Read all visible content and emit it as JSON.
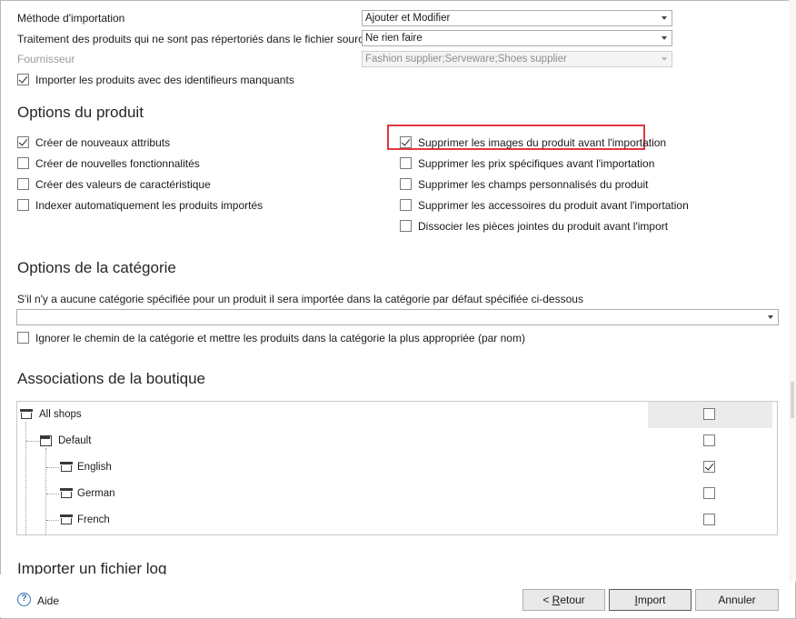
{
  "import_method": {
    "label": "Méthode d'importation",
    "value": "Ajouter et Modifier"
  },
  "unlisted_products": {
    "label": "Traitement des produits qui ne sont pas répertoriés dans le fichier source",
    "value": "Ne rien faire"
  },
  "supplier": {
    "label": "Fournisseur",
    "value": "Fashion supplier;Serveware;Shoes supplier"
  },
  "missing_identifiers": {
    "label": "Importer les produits avec des identifieurs manquants",
    "checked": true
  },
  "product_options": {
    "title": "Options du produit",
    "left": [
      {
        "label": "Créer de nouveaux attributs",
        "checked": true
      },
      {
        "label": "Créer de nouvelles fonctionnalités",
        "checked": false
      },
      {
        "label": "Créer des valeurs de caractéristique",
        "checked": false
      },
      {
        "label": "Indexer automatiquement les produits importés",
        "checked": false
      }
    ],
    "right": [
      {
        "label": "Supprimer les images du produit avant l'importation",
        "checked": true
      },
      {
        "label": "Supprimer les prix spécifiques avant l'importation",
        "checked": false
      },
      {
        "label": "Supprimer les champs personnalisés du produit",
        "checked": false
      },
      {
        "label": "Supprimer les accessoires du produit avant l'importation",
        "checked": false
      },
      {
        "label": "Dissocier les pièces jointes du produit avant l'import",
        "checked": false
      }
    ]
  },
  "category_options": {
    "title": "Options de la catégorie",
    "hint": "S'il n'y a aucune catégorie spécifiée pour un produit il sera importée dans la catégorie par défaut spécifiée ci-dessous",
    "default_category": "",
    "ignore_path": {
      "label": "Ignorer le chemin de la catégorie et mettre les produits dans la catégorie la plus appropriée (par nom)",
      "checked": false
    }
  },
  "shop_associations": {
    "title": "Associations de la boutique",
    "rows": [
      {
        "label": "All shops",
        "checked": false
      },
      {
        "label": "Default",
        "checked": false
      },
      {
        "label": "English",
        "checked": true
      },
      {
        "label": "German",
        "checked": false
      },
      {
        "label": "French",
        "checked": false
      }
    ]
  },
  "log_section": {
    "title": "Importer un fichier log"
  },
  "footer": {
    "help": "Aide",
    "back_prefix": "< ",
    "back_mnemonic": "R",
    "back_rest": "etour",
    "import_mnemonic": "I",
    "import_rest": "mport",
    "cancel": "Annuler"
  }
}
